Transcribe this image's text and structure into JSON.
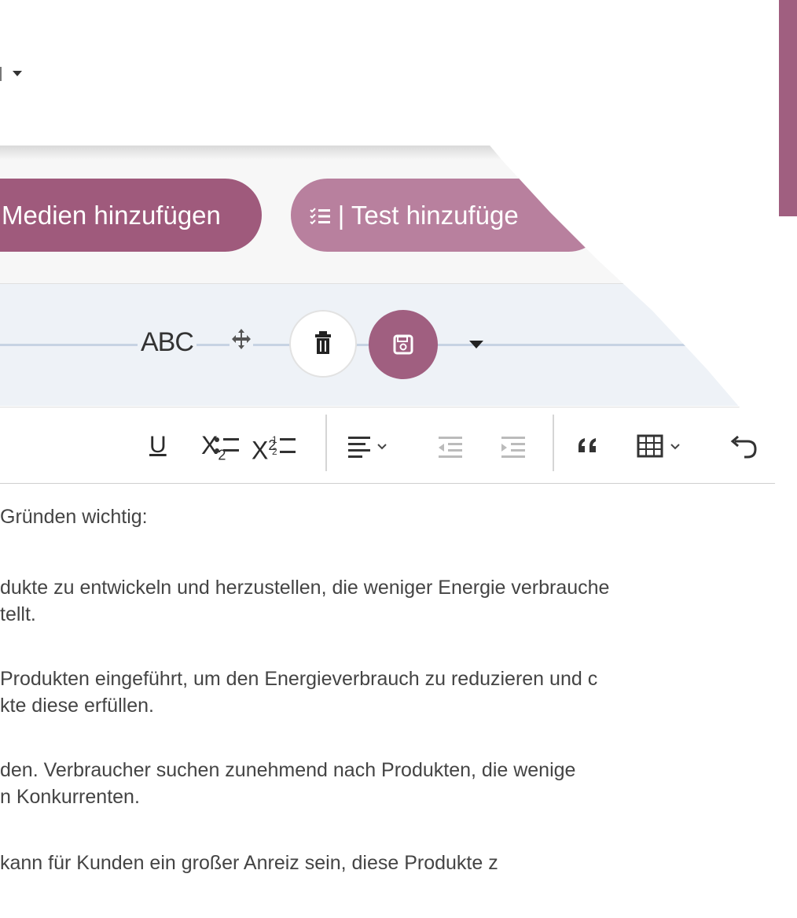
{
  "buttons": {
    "add_media": "Medien hinzufügen",
    "add_test": "| Test hinzufüge"
  },
  "edit": {
    "abc": "ABC"
  },
  "toolbar": {
    "underline": "U",
    "subscript": "X",
    "subscript_index": "2",
    "superscript": "X",
    "superscript_index": "2"
  },
  "content": {
    "line1": "Gründen wichtig:",
    "line2": "dukte zu entwickeln und herzustellen, die weniger Energie verbrauche",
    "line3": "tellt.",
    "line4": "Produkten eingeführt, um den Energieverbrauch zu reduzieren und c",
    "line5": "kte diese erfüllen.",
    "line6": "den. Verbraucher suchen zunehmend nach Produkten, die wenige",
    "line7": "n Konkurrenten.",
    "line8": "kann für Kunden ein großer Anreiz sein, diese Produkte z"
  },
  "colors": {
    "accent": "#a05f80",
    "accent_light": "#b8809e"
  }
}
